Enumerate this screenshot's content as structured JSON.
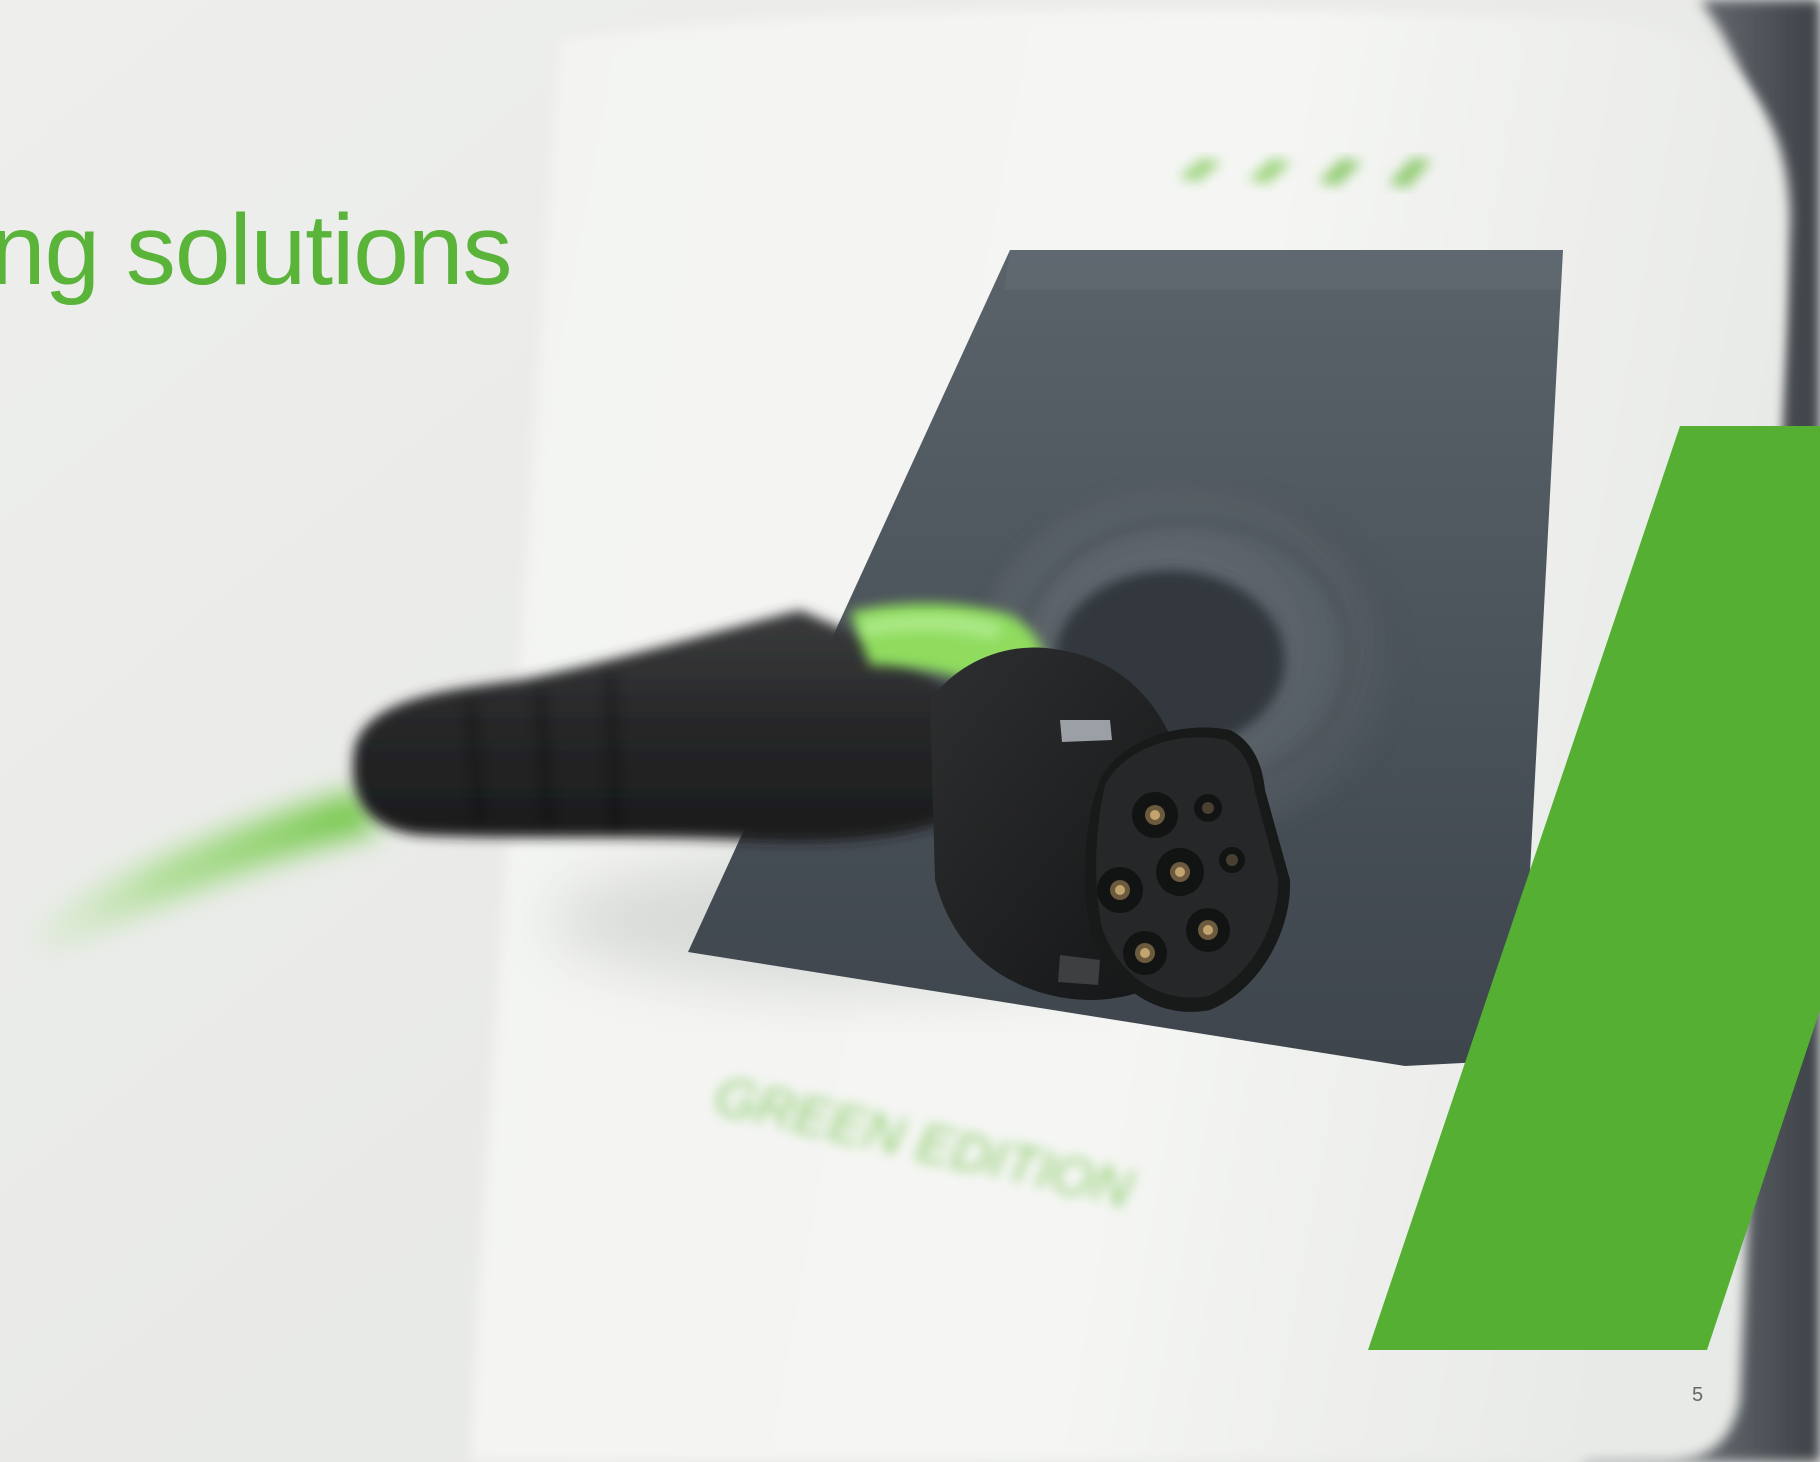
{
  "page": {
    "headline": "ging solutions",
    "page_number": "5"
  },
  "product": {
    "label": "GREEN EDITION",
    "status_lights": 4
  },
  "colors": {
    "background": "#ecedeb",
    "brand_green": "#55af32",
    "headline_green": "#5ab43a",
    "page_number": "#666666",
    "connector": "#1f2021",
    "panel": "#4e565e"
  }
}
